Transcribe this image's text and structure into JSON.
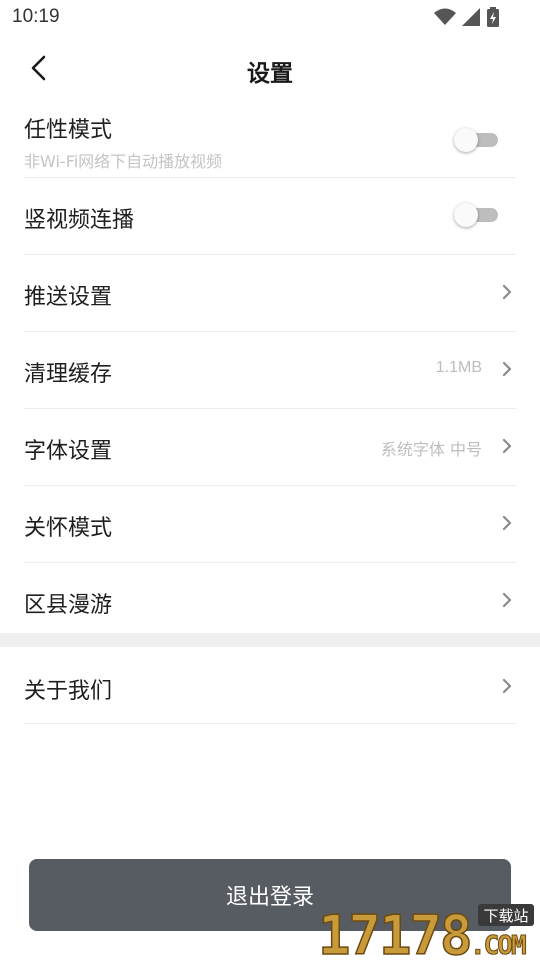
{
  "status": {
    "time": "10:19"
  },
  "header": {
    "title": "设置"
  },
  "settings": {
    "wifi_autoplay": {
      "label": "任性模式",
      "sub": "非Wi-Fi网络下自动播放视频",
      "enabled": false
    },
    "vertical_video": {
      "label": "竖视频连播",
      "enabled": false
    },
    "push": {
      "label": "推送设置"
    },
    "cache": {
      "label": "清理缓存",
      "value": "1.1MB"
    },
    "font": {
      "label": "字体设置",
      "value": "系统字体 中号"
    },
    "care": {
      "label": "关怀模式"
    },
    "roam": {
      "label": "区县漫游"
    }
  },
  "about": {
    "label": "关于我们"
  },
  "logout": {
    "label": "退出登录"
  },
  "watermark": {
    "number": "17178",
    "domain": ".COM",
    "tag": "下载站"
  },
  "colors": {
    "button_bg": "#575b62",
    "toggle_track": "#bdbdbd",
    "divider": "#efefef"
  }
}
